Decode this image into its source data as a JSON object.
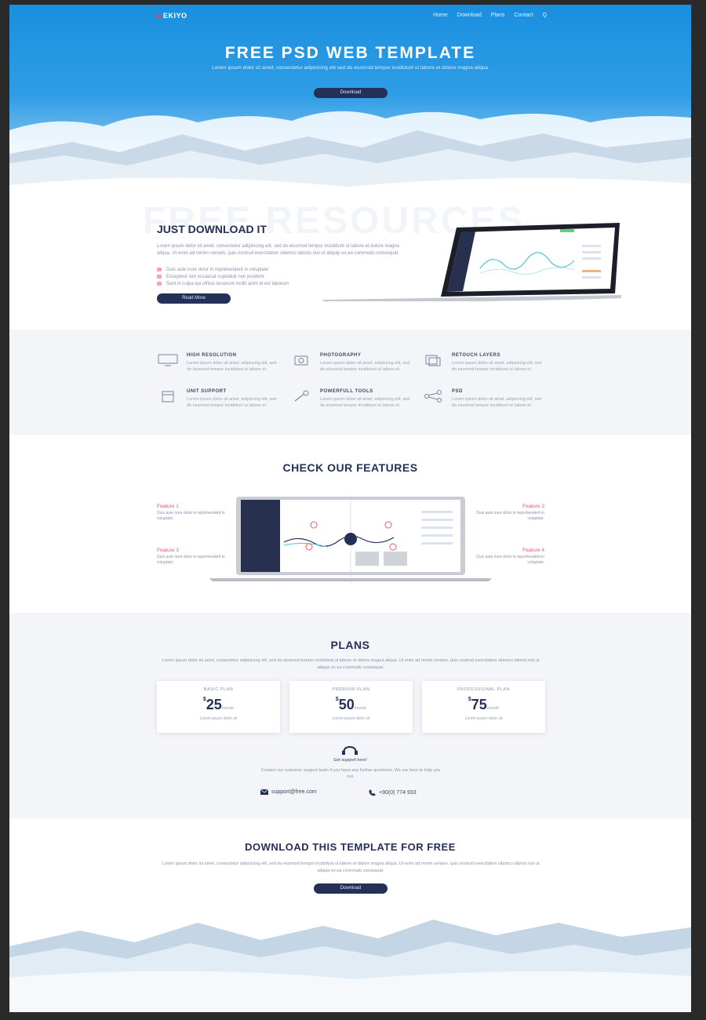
{
  "nav": {
    "logo": "EKIYO",
    "links": [
      "Home",
      "Download",
      "Plans",
      "Contact",
      "Q"
    ]
  },
  "hero": {
    "title": "FREE PSD WEB TEMPLATE",
    "subtitle": "Lorem ipsum dolor sit amet, consectetur adipisicing elit sed do eiusmod tempor incididunt ut labore et dolore magna aliqua.",
    "button": "Download"
  },
  "resources": {
    "ghost_title": "FREE RESOURCES",
    "title": "JUST DOWNLOAD IT",
    "text": "Lorem ipsum dolor sit amet, consectetur adipisicing elit, sed do eiusmod tempor incididunt ut labore et dolore magna aliqua. Ut enim ad minim veniam, quis nostrud exercitation ullamco laboris nisi ut aliquip ex ea commodo consequat.",
    "list": [
      "Duis aute irure dolor in reprehenderit in voluptate",
      "Excepteur sint occaecat cupidatat non proident",
      "Sunt in culpa qui officia deserunt mollit anim id est laborum"
    ],
    "button": "Read More"
  },
  "features_grid": [
    {
      "title": "HIGH RESOLUTION",
      "desc": "Lorem ipsum dolor sit amet, adipiscing elit, sed do eiusmod tempor incididunt ut labore et."
    },
    {
      "title": "PHOTOGRAPHY",
      "desc": "Lorem ipsum dolor sit amet, adipiscing elit, sed do eiusmod tempor incididunt ut labore et."
    },
    {
      "title": "RETOUCH LAYERS",
      "desc": "Lorem ipsum dolor sit amet, adipiscing elit, sed do eiusmod tempor incididunt ut labore et."
    },
    {
      "title": "UNIT SUPPORT",
      "desc": "Lorem ipsum dolor sit amet, adipiscing elit, sed do eiusmod tempor incididunt ut labore et."
    },
    {
      "title": "POWERFULL TOOLS",
      "desc": "Lorem ipsum dolor sit amet, adipiscing elit, sed do eiusmod tempor incididunt ut labore et."
    },
    {
      "title": "PSD",
      "desc": "Lorem ipsum dolor sit amet, adipiscing elit, sed do eiusmod tempor incididunt ut labore et."
    }
  ],
  "check": {
    "title": "CHECK OUR FEATURES",
    "callouts": [
      {
        "title": "Feature 1",
        "desc": "Duis aute irure dolor in reprehenderit in voluptate."
      },
      {
        "title": "Feature 2",
        "desc": "Duis aute irure dolor in reprehenderit in voluptate."
      },
      {
        "title": "Feature 3",
        "desc": "Duis aute irure dolor in reprehenderit in voluptate."
      },
      {
        "title": "Feature 4",
        "desc": "Duis aute irure dolor in reprehenderit in voluptate."
      }
    ]
  },
  "plans": {
    "title": "PLANS",
    "text": "Lorem ipsum dolor sit amet, consectetur adipisicing elit, sed do eiusmod tempor incididunt ut labore et dolore magna aliqua. Ut enim ad minim veniam, quis nostrud exercitation ullamco laboris nisi ut aliquip ex ea commodo consequat.",
    "cards": [
      {
        "name": "BASIC PLAN",
        "currency": "$",
        "price": "25",
        "period": "/month",
        "feature": "Lorem ipsum dolor sit"
      },
      {
        "name": "PREMIUM PLAN",
        "currency": "$",
        "price": "50",
        "period": "/month",
        "feature": "Lorem ipsum dolor sit"
      },
      {
        "name": "PROFESSIONAL PLAN",
        "currency": "$",
        "price": "75",
        "period": "/month",
        "feature": "Lorem ipsum dolor sit"
      }
    ],
    "support_title": "Get support here!",
    "support_text": "Contact our customer support team if you have any further questions. We are here to help you out.",
    "email": "support@free.com",
    "phone": "+90(0) 774 933"
  },
  "final": {
    "title": "DOWNLOAD THIS TEMPLATE FOR FREE",
    "text": "Lorem ipsum dolor sit amet, consectetur adipisicing elit, sed do eiusmod tempor incididunt ut labore et dolore magna aliqua. Ut enim ad minim veniam, quis nostrud exercitation ullamco laboris nisi ut aliquip ex ea commodo consequat.",
    "button": "Download"
  },
  "colors": {
    "accent": "#e8435c",
    "navy": "#243058",
    "sky": "#1a8fde",
    "gray_bg": "#f3f5f8"
  }
}
